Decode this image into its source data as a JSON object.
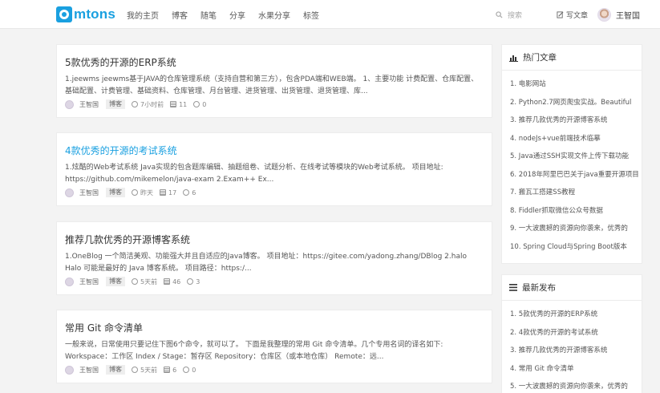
{
  "header": {
    "logo_text": "mtons",
    "nav": [
      "我的主页",
      "博客",
      "随笔",
      "分享",
      "水果分享",
      "标签"
    ],
    "search_placeholder": "搜索",
    "write_label": "写文章",
    "user_name": "王智国"
  },
  "posts": [
    {
      "title": "5款优秀的开源的ERP系统",
      "summary": "1.jeewms jeewms基于JAVA的仓库管理系统（支持自营和第三方），包含PDA端和WEB端。 1、主要功能   计费配置、仓库配置、基础配置、计费管理、基础资料、仓库管理、月台管理、进货管理、出货管理、退货管理、库...",
      "author": "王智国",
      "tag": "博客",
      "time": "7小时前",
      "views": "11",
      "comments": "0"
    },
    {
      "title": "4款优秀的开源的考试系统",
      "summary": "1.炫酷的Web考试系统 Java实现的包含题库编辑、抽题组卷、试题分析、在线考试等模块的Web考试系统。 项目地址: https://github.com/mikemelon/java-exam   2.Exam++ Ex...",
      "author": "王智国",
      "tag": "博客",
      "time": "昨天",
      "views": "17",
      "comments": "6"
    },
    {
      "title": "推荐几款优秀的开源博客系统",
      "summary": "1.OneBlog 一个简洁美观、功能强大并且自适应的Java博客。 项目地址：https://gitee.com/yadong.zhang/DBlog 2.halo Halo 可能是最好的 Java 博客系统。 项目路径：https:/...",
      "author": "王智国",
      "tag": "博客",
      "time": "5天前",
      "views": "46",
      "comments": "3"
    },
    {
      "title": "常用 Git 命令清单",
      "summary": "一般来说，日常使用只要记住下图6个命令，就可以了。 下面是我整理的常用 Git 命令清单。几个专用名词的译名如下: Workspace：工作区 Index / Stage：暂存区 Repository：仓库区（或本地仓库） Remote：远...",
      "author": "王智国",
      "tag": "博客",
      "time": "5天前",
      "views": "6",
      "comments": "0"
    }
  ],
  "hot": {
    "title": "热门文章",
    "items": [
      "1. 电影网站",
      "2. Python2.7网页爬虫实战。Beautiful",
      "3. 推荐几款优秀的开源博客系统",
      "4. nodeJs+vue前端技术临摹",
      "5. Java通过SSH实现文件上传下载功能",
      "6. 2018年阿里巴巴关于java重要开源项目",
      "7. 搬瓦工搭建SS教程",
      "8. Fiddler抓取微信公众号数据",
      "9. 一大波震撼的资源向你袭来，优秀的",
      "10. Spring Cloud与Spring Boot版本"
    ]
  },
  "latest": {
    "title": "最新发布",
    "items": [
      "1. 5款优秀的开源的ERP系统",
      "2. 4款优秀的开源的考试系统",
      "3. 推荐几款优秀的开源博客系统",
      "4. 常用 Git 命令清单",
      "5. 一大波震撼的资源向你袭来，优秀的"
    ]
  }
}
